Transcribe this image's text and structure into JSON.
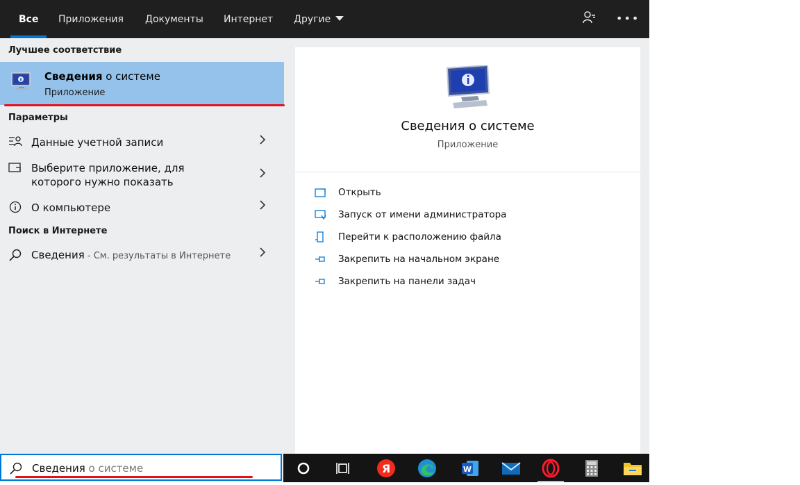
{
  "tabs": [
    {
      "label": "Все",
      "active": true
    },
    {
      "label": "Приложения"
    },
    {
      "label": "Документы"
    },
    {
      "label": "Интернет"
    },
    {
      "label": "Другие"
    }
  ],
  "topbar_icons": [
    "feedback-icon",
    "more-options-icon"
  ],
  "sections": {
    "best_match": "Лучшее соответствие",
    "settings": "Параметры",
    "web_search": "Поиск в Интернете"
  },
  "best_match": {
    "title_bold": "Сведения",
    "title_rest": " о системе",
    "subtitle": "Приложение",
    "icon": "system-info-icon"
  },
  "settings_items": [
    {
      "icon": "account-info-icon",
      "label": "Данные учетной записи"
    },
    {
      "icon": "app-display-icon",
      "label_line1": "Выберите приложение, для",
      "label_line2": "которого нужно показать"
    },
    {
      "icon": "info-circle-icon",
      "label": "О компьютере"
    }
  ],
  "web_result": {
    "icon": "search-icon",
    "query": "Сведения",
    "suffix": " - См. результаты в Интернете"
  },
  "detail": {
    "title": "Сведения о системе",
    "subtitle": "Приложение",
    "actions": [
      {
        "icon": "open-icon",
        "label": "Открыть"
      },
      {
        "icon": "run-as-admin-icon",
        "label": "Запуск от имени администратора"
      },
      {
        "icon": "file-location-icon",
        "label": "Перейти к расположению файла"
      },
      {
        "icon": "pin-start-icon",
        "label": "Закрепить на начальном экране"
      },
      {
        "icon": "pin-taskbar-icon",
        "label": "Закрепить на панели задач"
      }
    ]
  },
  "search": {
    "typed": "Сведения",
    "suggestion": " о системе"
  },
  "taskbar": [
    "cortana-icon",
    "task-view-icon",
    "yandex-browser-icon",
    "edge-icon",
    "word-icon",
    "mail-icon",
    "opera-icon",
    "calculator-icon",
    "file-explorer-icon"
  ],
  "colors": {
    "accent": "#0078d7",
    "selection": "#95c2ea",
    "annotation_red": "#e3101c",
    "topbar": "#1f1f1f",
    "taskbar": "#141414"
  }
}
